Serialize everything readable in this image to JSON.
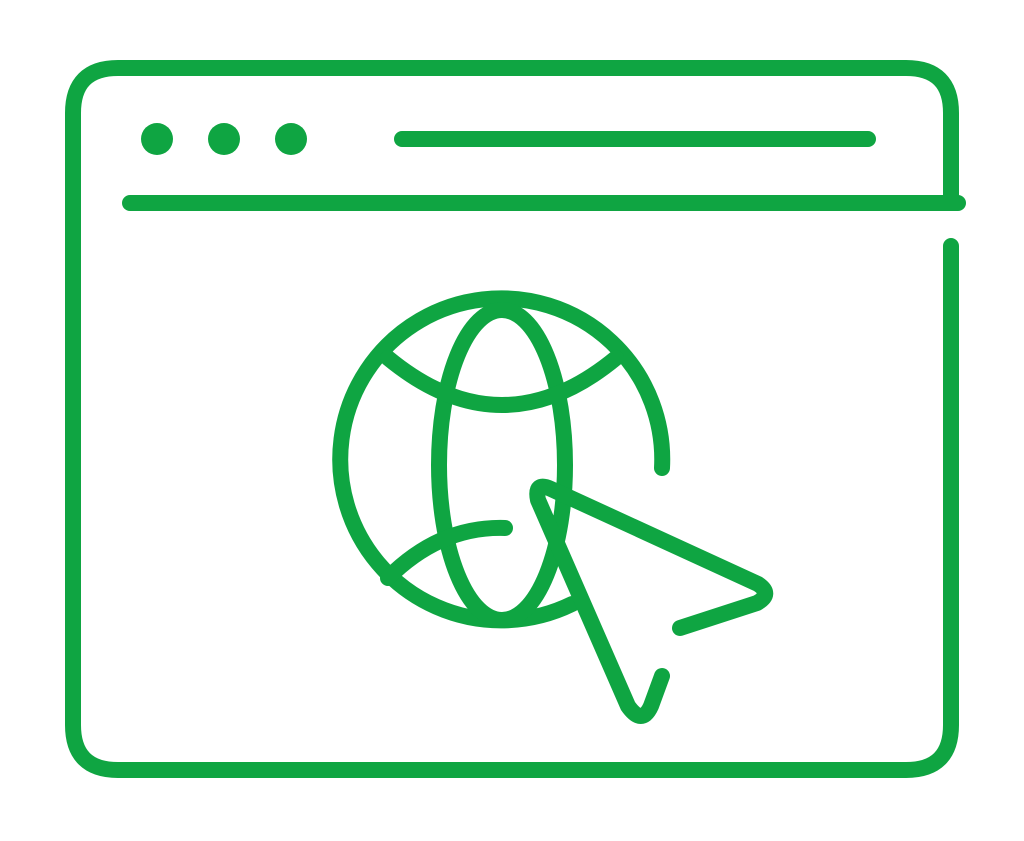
{
  "icon": {
    "name": "web-browser-globe-cursor-icon",
    "colors": {
      "stroke": "#0fa542",
      "background": "#ffffff"
    },
    "parts": {
      "window": "browser-window-icon",
      "dots": "window-control-dots-icon",
      "address_bar": "address-bar-line-icon",
      "globe": "globe-icon",
      "cursor": "mouse-pointer-icon"
    }
  }
}
